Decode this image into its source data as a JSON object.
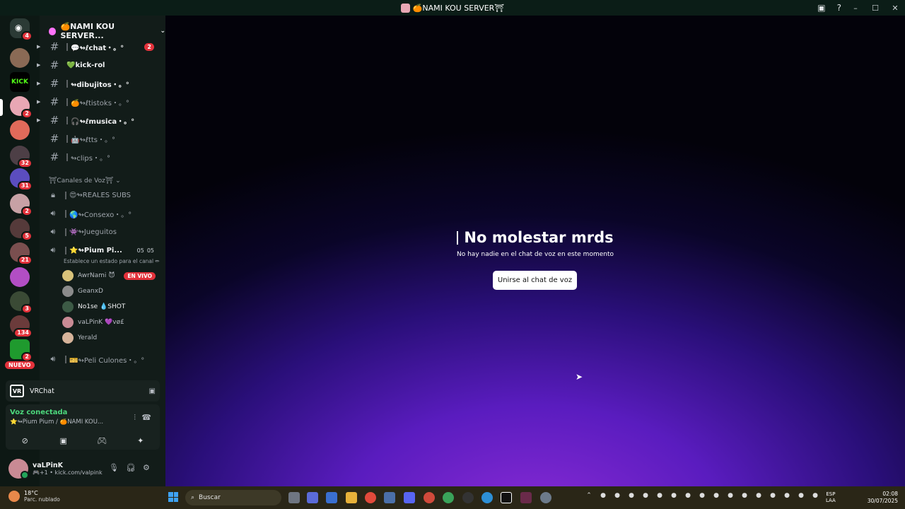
{
  "window": {
    "title": "🍊NAMI KOU SERVER⛩",
    "controls": {
      "minimize": "–",
      "maximize": "☐",
      "close": "✕"
    },
    "extra_icons": [
      "inbox-icon",
      "help-icon"
    ]
  },
  "guilds": {
    "home_badge": "4",
    "kick_label": "KICK",
    "badges": [
      "2",
      "32",
      "31",
      "2",
      "5",
      "21",
      "3",
      "134",
      "2"
    ],
    "nuevo": "NUEVO"
  },
  "server": {
    "name": "🍊NAMI KOU SERVER...",
    "text_channels": [
      {
        "name": "💬↬ℓchat・。°",
        "unread": true,
        "badge": "2",
        "arrow": true
      },
      {
        "name": "💚kick-rol",
        "unread": true,
        "badge": "",
        "arrow": true
      },
      {
        "name": "↬dibujitos・。°",
        "unread": true,
        "badge": "",
        "arrow": true
      },
      {
        "name": "🍊↬ℓtistoks・。°",
        "unread": false,
        "badge": "",
        "arrow": true
      },
      {
        "name": "🎧↬ℓmusica・。°",
        "unread": true,
        "badge": "",
        "arrow": true
      },
      {
        "name": "🤖↬ℓtts・。°",
        "unread": false,
        "badge": "",
        "arrow": false
      },
      {
        "name": "↬clips・。°",
        "unread": false,
        "badge": "",
        "arrow": false
      }
    ],
    "voice_category": "⛩Canales de Voz⛩",
    "voice_channels": [
      {
        "name": "😍↬REALES SUBS",
        "icon": "lock-icon"
      },
      {
        "name": "🌎↬Consexo・。°",
        "icon": "speaker-icon"
      },
      {
        "name": "👾↬Jueguitos",
        "icon": "speaker-icon"
      },
      {
        "name": "⭐↬Pium Pi...",
        "icon": "speaker-icon",
        "count_a": "05",
        "count_b": "05"
      },
      {
        "name": "🎫↬Peli Culones・。°",
        "icon": "speaker-icon"
      }
    ],
    "status_hint": "Establece un estado para el canal ✏",
    "voice_users": [
      {
        "name": "AwrNami 😈",
        "live": "EN VIVO"
      },
      {
        "name": "GeanxD",
        "live": ""
      },
      {
        "name": "No1se 💧SHOT",
        "live": ""
      },
      {
        "name": "vaLPinK 💜vø£",
        "live": ""
      },
      {
        "name": "Yerald",
        "live": ""
      }
    ]
  },
  "activity": {
    "app": "VRChat",
    "logo": "VR"
  },
  "voice": {
    "connected": "Voz conectada",
    "channel": "⭐↬Pium Pium / 🍊NAMI KOU..."
  },
  "user": {
    "name": "vaLPinK",
    "status": "🎮+1 • kick.com/valpink"
  },
  "main": {
    "title": "No molestar mrds",
    "subtitle": "No hay nadie en el chat de voz en este momento",
    "join_button": "Unirse al chat de voz"
  },
  "taskbar": {
    "temp": "18°C",
    "weather": "Parc. nublado",
    "search_placeholder": "Buscar",
    "lang_a": "ESP",
    "lang_b": "LAA",
    "time": "02:08",
    "date": "30/07/2025"
  }
}
